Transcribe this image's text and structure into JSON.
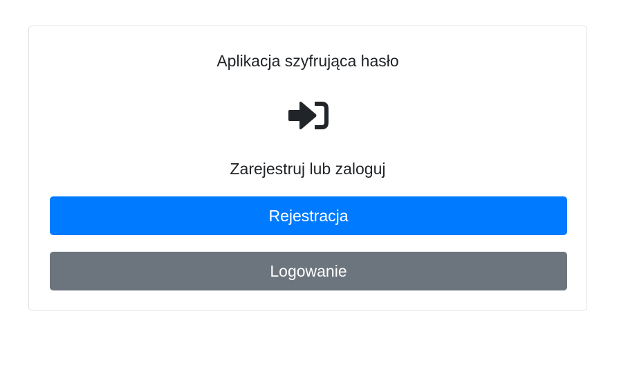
{
  "card": {
    "title": "Aplikacja szyfrująca hasło",
    "icon": "sign-in-icon",
    "subtitle": "Zarejestruj lub zaloguj"
  },
  "buttons": {
    "register_label": "Rejestracja",
    "login_label": "Logowanie"
  },
  "colors": {
    "primary": "#007bff",
    "secondary": "#6c757d",
    "text": "#212529",
    "border": "#dfe1e4"
  }
}
